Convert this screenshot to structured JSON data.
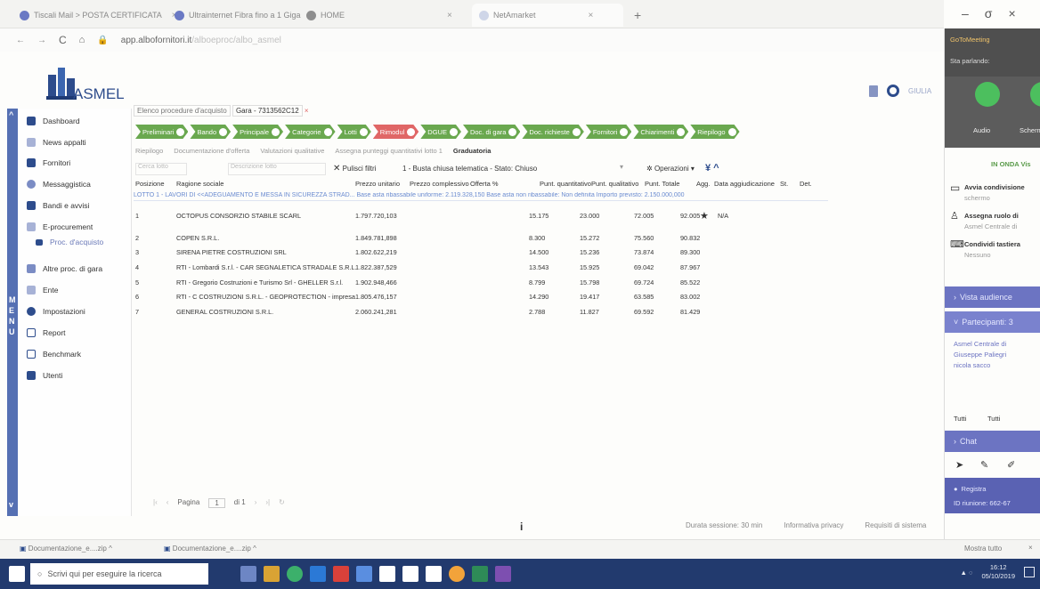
{
  "browser": {
    "tabs": [
      {
        "label": "Tiscali Mail > POSTA CERTIFICATA"
      },
      {
        "label": "Ultrainternet Fibra fino a 1 Giga"
      },
      {
        "label": "HOME"
      },
      {
        "label": "NetAmarket"
      }
    ],
    "new_tab": "+",
    "url": "app.albofornitori.it",
    "url_suffix": "/alboeproc/albo_asmel"
  },
  "window": {
    "minimize": "–",
    "restore": "σ",
    "close": "×"
  },
  "app": {
    "logo_text": "ASMEL",
    "user_label": "GIULIA"
  },
  "sidebar": {
    "menu_letters": [
      "M",
      "E",
      "N",
      "U"
    ],
    "items": [
      {
        "label": "Dashboard",
        "icon": "home-icon"
      },
      {
        "label": "News appalti",
        "icon": "news-icon"
      },
      {
        "label": "Fornitori",
        "icon": "suppliers-icon"
      },
      {
        "label": "Messaggistica",
        "icon": "messages-icon"
      },
      {
        "label": "Bandi e avvisi",
        "icon": "megaphone-icon"
      },
      {
        "label": "E-procurement",
        "icon": "eprocurement-icon"
      },
      {
        "label": "Proc. d'acquisto",
        "icon": "list-icon"
      },
      {
        "label": "Altre proc. di gara",
        "icon": "folder-icon"
      },
      {
        "label": "Ente",
        "icon": "entity-icon"
      },
      {
        "label": "Impostazioni",
        "icon": "gear-icon"
      },
      {
        "label": "Report",
        "icon": "report-icon"
      },
      {
        "label": "Benchmark",
        "icon": "benchmark-icon"
      },
      {
        "label": "Utenti",
        "icon": "users-icon"
      }
    ]
  },
  "breadcrumb": {
    "back": "Elenco procedure d'acquisto",
    "current": "Gara - 7313562C12"
  },
  "steps": [
    {
      "label": "Preliminari",
      "color": "#6aa84f"
    },
    {
      "label": "Bando",
      "color": "#6aa84f"
    },
    {
      "label": "Principale",
      "color": "#6aa84f"
    },
    {
      "label": "Categorie",
      "color": "#6aa84f"
    },
    {
      "label": "Lotti",
      "color": "#6aa84f"
    },
    {
      "label": "Rimodul",
      "color": "#e06666"
    },
    {
      "label": "DGUE",
      "color": "#6aa84f"
    },
    {
      "label": "Doc. di gara",
      "color": "#6aa84f"
    },
    {
      "label": "Doc. richieste",
      "color": "#6aa84f"
    },
    {
      "label": "Fornitori",
      "color": "#6aa84f"
    },
    {
      "label": "Chiarimenti",
      "color": "#6aa84f"
    },
    {
      "label": "Riepilogo",
      "color": "#6aa84f"
    }
  ],
  "subtabs": [
    {
      "label": "Riepilogo"
    },
    {
      "label": "Documentazione d'offerta"
    },
    {
      "label": "Valutazioni qualitative"
    },
    {
      "label": "Assegna punteggi quantitativi lotto 1"
    },
    {
      "label": "Graduatoria"
    }
  ],
  "filters": {
    "search_placeholder": "Cerca lotto",
    "desc_placeholder": "Descrizione lotto",
    "clear": "Pulisci filtri",
    "busta": "1 - Busta chiusa telematica - Stato: Chiuso",
    "operations": "Operazioni"
  },
  "columns": [
    "Posizione",
    "Ragione sociale",
    "Prezzo unitario",
    "Prezzo complessivo",
    "Offerta %",
    "Punt. quantitativo",
    "Punt. qualitativo",
    "Punt. Totale",
    "Agg.",
    "Data aggiudicazione",
    "St.",
    "Det."
  ],
  "lot_line": "LOTTO 1 - LAVORI DI <<ADEGUAMENTO E MESSA IN SICUREZZA STRAD...   Base asta ribassabile uniforme: 2.119.328,150   Base asta non ribassabile: Non definita   Importo previsto: 2.150.000,000",
  "rows": [
    {
      "pos": "1",
      "name": "OCTOPUS CONSORZIO STABILE SCARL",
      "price": "1.797.720,103",
      "q": "15.175",
      "ql": "23.000",
      "tot": "72.005",
      "tot2": "92.005",
      "agg": "N/A"
    },
    {
      "pos": "2",
      "name": "COPEN S.R.L.",
      "price": "1.849.781,898",
      "q": "8.300",
      "ql": "15.272",
      "tot": "75.560",
      "tot2": "90.832"
    },
    {
      "pos": "3",
      "name": "SIRENA PIETRE COSTRUZIONI SRL",
      "price": "1.802.622,219",
      "q": "14.500",
      "ql": "15.236",
      "tot": "73.874",
      "tot2": "89.300"
    },
    {
      "pos": "4",
      "name": "RTI - Lombardi S.r.l. - CAR SEGNALETICA STRADALE S.R.L.",
      "price": "1.822.387,529",
      "q": "13.543",
      "ql": "15.925",
      "tot": "69.042",
      "tot2": "87.967"
    },
    {
      "pos": "5",
      "name": "RTI - Gregorio Costruzioni e Turismo Srl - GHELLER S.r.l.",
      "price": "1.902.948,466",
      "q": "8.799",
      "ql": "15.798",
      "tot": "69.724",
      "tot2": "85.522"
    },
    {
      "pos": "6",
      "name": "RTI - C COSTRUZIONI S.R.L. - GEOPROTECTION - impresa",
      "price": "1.805.476,157",
      "q": "14.290",
      "ql": "19.417",
      "tot": "63.585",
      "tot2": "83.002"
    },
    {
      "pos": "7",
      "name": "GENERAL COSTRUZIONI S.R.L.",
      "price": "2.060.241,281",
      "q": "2.788",
      "ql": "11.827",
      "tot": "69.592",
      "tot2": "81.429"
    }
  ],
  "pager": {
    "prefix": "Pagina",
    "page": "1",
    "of": "di 1"
  },
  "footer": {
    "session": "Durata sessione: 30 min",
    "privacy": "Informativa privacy",
    "requirements": "Requisiti di sistema"
  },
  "downloads": {
    "items": [
      "Documentazione_e....zip",
      "Documentazione_e....zip"
    ],
    "show_all": "Mostra tutto",
    "close": "×"
  },
  "taskbar": {
    "search": "Scrivi qui per eseguire la ricerca",
    "time": "16:12",
    "date": "05/10/2019"
  },
  "meeting": {
    "title": "GoToMeeting",
    "speaking": "Sta parlando:",
    "audio": "Audio",
    "screen": "Schermo",
    "live": "IN ONDA  Vis",
    "actions": [
      {
        "title": "Avvia condivisione",
        "sub": "schermo"
      },
      {
        "title": "Assegna ruolo di",
        "sub": "Asmel Centrale di"
      },
      {
        "title": "Condividi tastiera",
        "sub": "Nessuno"
      }
    ],
    "audience": "Vista audience",
    "participants": "Partecipanti: 3",
    "people": [
      "Asmel Centrale di",
      "Giuseppe Paliegri",
      "nicola sacco"
    ],
    "all": "Tutti",
    "all2": "Tutti",
    "chat": "Chat",
    "record": "Registra",
    "meeting_id": "ID riunione: 662-67"
  }
}
